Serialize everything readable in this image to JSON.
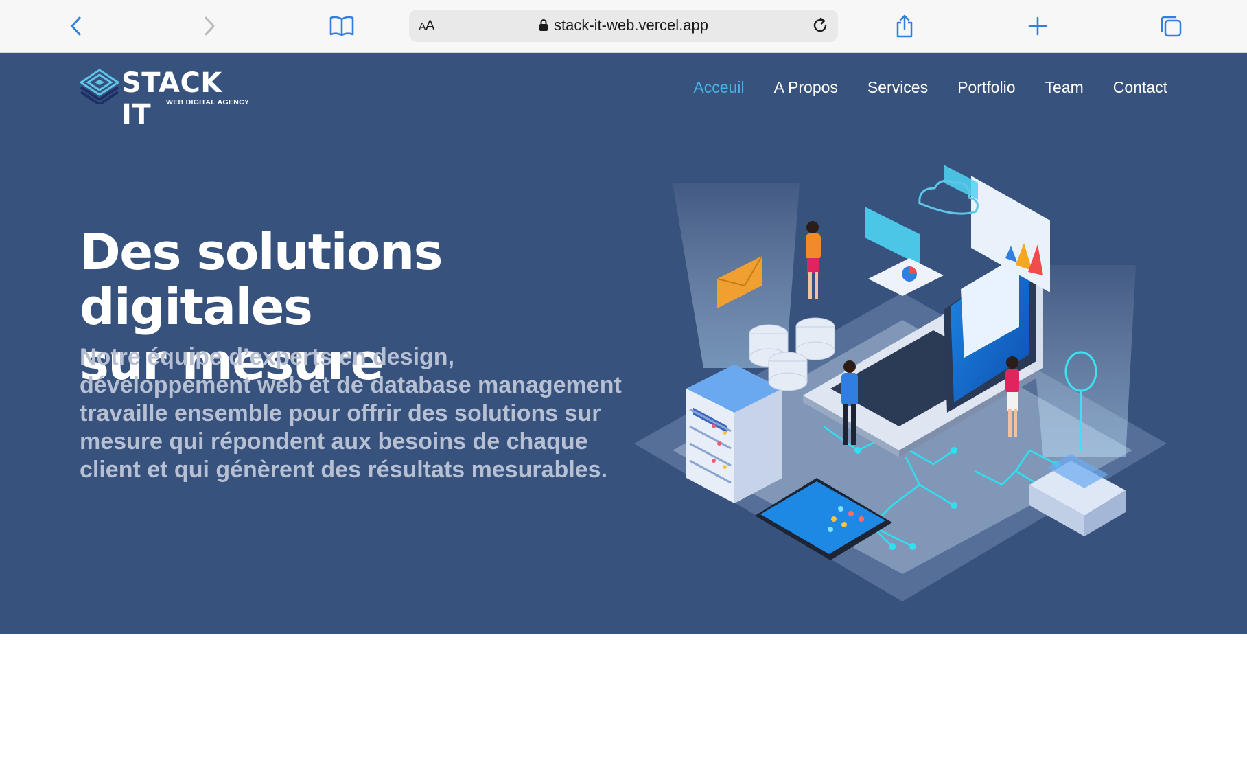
{
  "browser": {
    "reader_label_big": "A",
    "reader_label_small": "A",
    "url": "stack-it-web.vercel.app",
    "icons": [
      "back-chevron-icon",
      "forward-chevron-icon",
      "bookmarks-book-icon",
      "lock-icon",
      "reload-icon",
      "share-icon",
      "plus-icon",
      "tabs-icon"
    ]
  },
  "site": {
    "logo": {
      "name": "STACK IT",
      "tagline": "WEB DIGITAL AGENCY"
    },
    "nav": [
      {
        "label": "Acceuil",
        "active": true
      },
      {
        "label": "A Propos",
        "active": false
      },
      {
        "label": "Services",
        "active": false
      },
      {
        "label": "Portfolio",
        "active": false
      },
      {
        "label": "Team",
        "active": false
      },
      {
        "label": "Contact",
        "active": false
      }
    ],
    "hero": {
      "title_line1": "Des solutions digitales",
      "title_line2": "sur mesure",
      "description": "Notre équipe d’experts en design, développement web et de database management travaille ensemble pour offrir des solutions sur mesure qui répondent aux besoins de chaque client et qui génèrent des résultats mesurables."
    }
  },
  "colors": {
    "toolbar_bg": "#f7f7f7",
    "ios_blue": "#2f7ee0",
    "hero_bg": "#38527e",
    "nav_active": "#47b2e4",
    "subtext": "#b7c0d2"
  }
}
